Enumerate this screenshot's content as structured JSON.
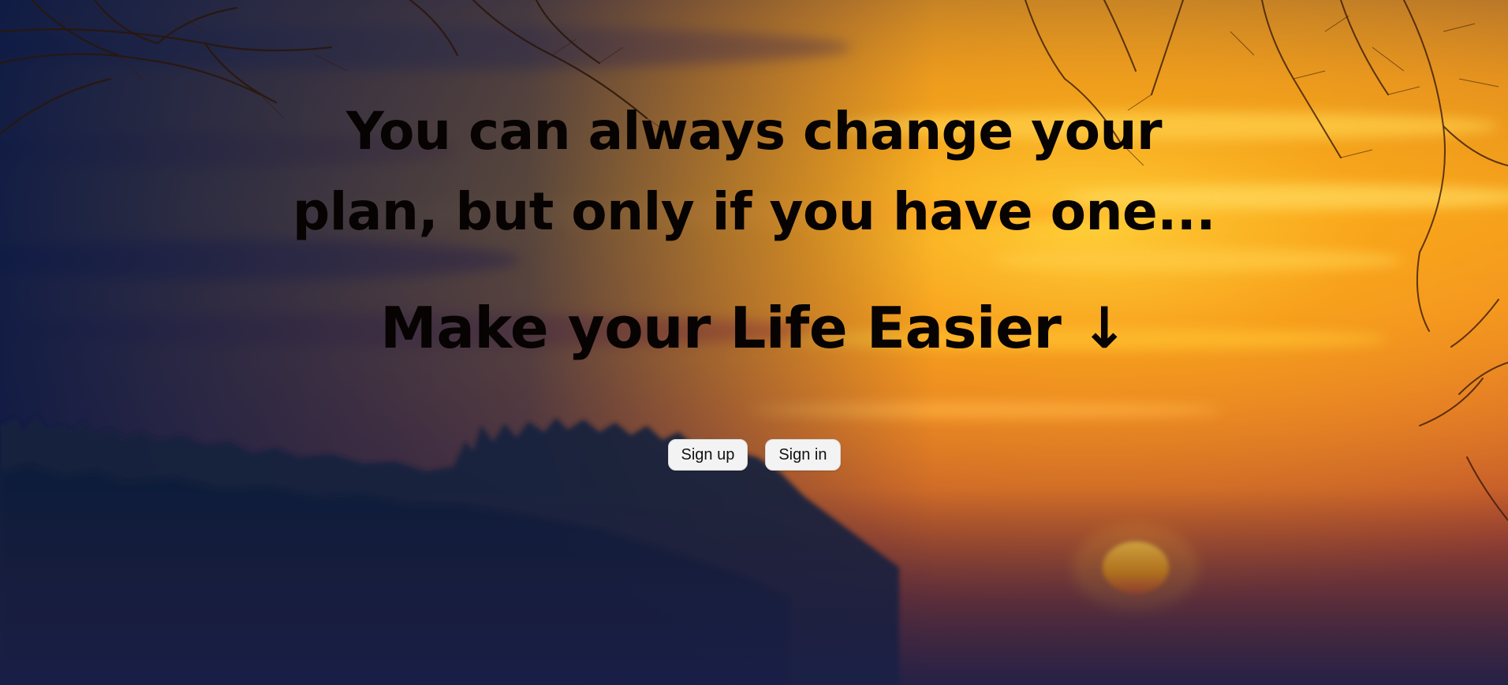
{
  "hero": {
    "quote_line1": "You can always change your",
    "quote_line2": "plan, but only if you have one...",
    "tagline": "Make your Life Easier ↓"
  },
  "actions": {
    "sign_up_label": "Sign up",
    "sign_in_label": "Sign in"
  },
  "colors": {
    "sky_top": "#c9771f",
    "sky_glow": "#ffb21a",
    "horizon": "#e2641c",
    "forest": "#1f2440",
    "ground_dark": "#0f1c45",
    "sun": "#ff9d00",
    "text": "#060302",
    "button_bg": "#f3f3f3"
  }
}
